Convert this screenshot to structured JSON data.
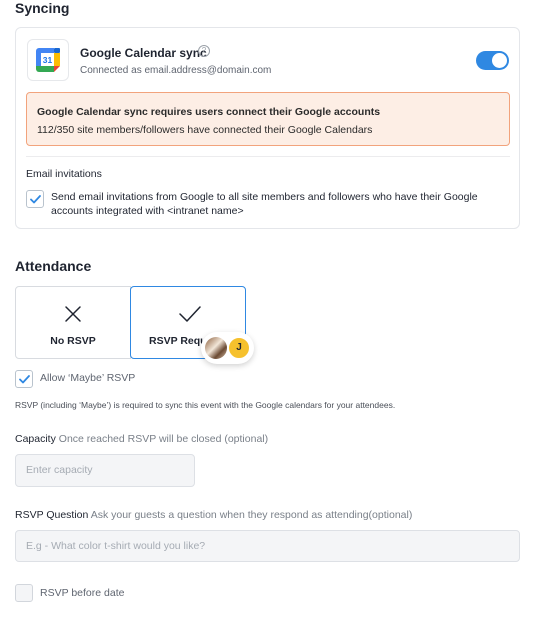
{
  "syncing": {
    "title": "Syncing",
    "gcal": {
      "logo_text": "31",
      "title": "Google Calendar sync",
      "help_icon": "?",
      "connected_text": "Connected as email.address@domain.com",
      "toggle_on": true
    },
    "warning": {
      "line1": "Google Calendar sync requires users connect their Google accounts",
      "line2": "112/350 site members/followers have connected their Google Calendars"
    },
    "email": {
      "label": "Email invitations",
      "checked": true,
      "text": "Send email invitations from Google to all site members and followers who have their Google accounts integrated with <intranet name>"
    }
  },
  "attendance": {
    "title": "Attendance",
    "options": [
      {
        "label": "No RSVP",
        "icon": "x-icon",
        "selected": false
      },
      {
        "label": "RSVP Required",
        "icon": "check-icon",
        "selected": true
      }
    ],
    "avatar_initial": "J",
    "maybe_label": "Allow ‘Maybe’ RSVP",
    "maybe_checked": true,
    "note": "RSVP (including ‘Maybe’) is required to sync this event with the Google calendars for your attendees."
  },
  "capacity": {
    "label": "Capacity",
    "hint": "Once reached RSVP will be closed (optional)",
    "placeholder": "Enter capacity"
  },
  "question": {
    "label": "RSVP Question",
    "hint": "Ask your guests a question when they respond as attending(optional)",
    "placeholder": "E.g - What color t-shirt would you like?"
  },
  "before_date": {
    "label": "RSVP before date",
    "checked": false
  },
  "colors": {
    "accent": "#2f88e2",
    "warning_bg": "#fdeee5",
    "warning_border": "#f2a37c",
    "avatar_yellow": "#f6c12d"
  }
}
